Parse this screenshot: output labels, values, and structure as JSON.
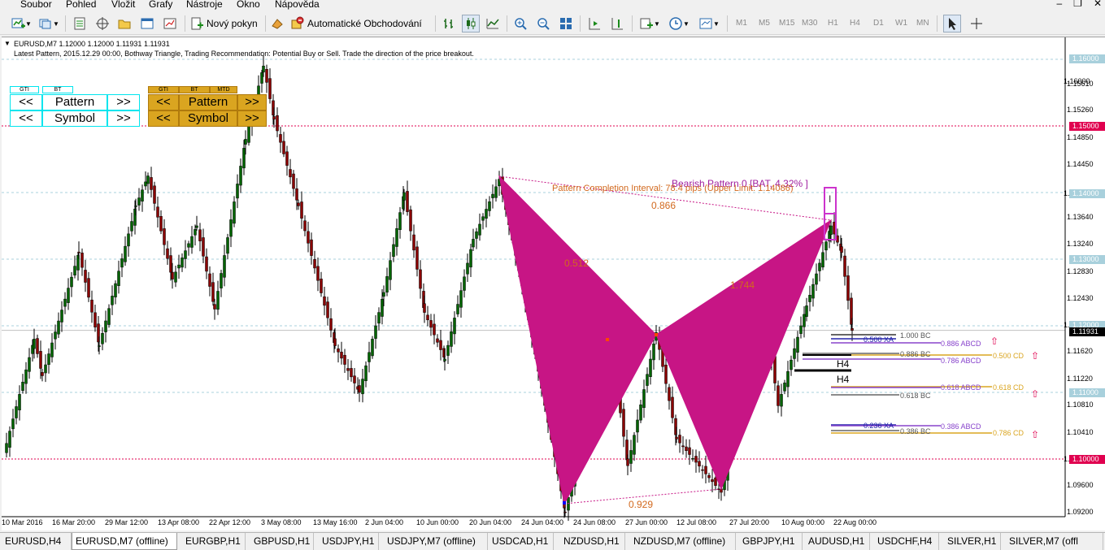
{
  "menu": [
    "Soubor",
    "Pohled",
    "Vložit",
    "Grafy",
    "Nástroje",
    "Okno",
    "Nápověda"
  ],
  "toolbar": {
    "new_order": "Nový pokyn",
    "auto_trading": "Automatické Obchodování",
    "timeframes": [
      "M1",
      "M5",
      "M15",
      "M30",
      "H1",
      "H4",
      "D1",
      "W1",
      "MN"
    ]
  },
  "chart": {
    "symbol_line": "EURUSD,M7  1.12000 1.12000 1.11931 1.11931",
    "info_line": "Latest Pattern, 2015.12.29 00:00, Bothway Triangle, Trading Recommendation: Potential Buy or Sell. Trade the direction of the price breakout.",
    "panel_cyan": {
      "tags": [
        "GTI",
        "BT"
      ],
      "prev": "<<",
      "next": ">>",
      "row1": "Pattern",
      "row2": "Symbol"
    },
    "panel_gold": {
      "tags": [
        "GTI",
        "BT",
        "MTD"
      ],
      "prev": "<<",
      "next": ">>",
      "row1": "Pattern",
      "row2": "Symbol"
    },
    "pattern_title": "Bearish Pattern 0  [BAT, 4.32% ]",
    "pattern_interval": "Pattern Completion Interval: 78.4 pips (Upper Limit: 1.14086)",
    "ratios": [
      "0.866",
      "0.512",
      "1.744",
      "0.929"
    ],
    "prz_marker": "I",
    "levels": [
      {
        "label": "1.000 BC",
        "color": "#333333"
      },
      {
        "label": "0.500 XA",
        "color": "#2222aa"
      },
      {
        "label": "0.886 ABCD",
        "color": "#8844cc"
      },
      {
        "label": "0.886 BC",
        "color": "#666666"
      },
      {
        "label": "0.500 CD",
        "color": "#daa520"
      },
      {
        "label": "0.786 ABCD",
        "color": "#8844cc"
      },
      {
        "label": "H4",
        "color": "#000000"
      },
      {
        "label": "H4",
        "color": "#000000"
      },
      {
        "label": "0.618 ABCD",
        "color": "#8844cc"
      },
      {
        "label": "0.618 CD",
        "color": "#daa520"
      },
      {
        "label": "0.618 BC",
        "color": "#666666"
      },
      {
        "label": "0.236 XA",
        "color": "#2222aa"
      },
      {
        "label": "0.386 ABCD",
        "color": "#8844cc"
      },
      {
        "label": "0.386 BC",
        "color": "#666666"
      },
      {
        "label": "0.786 CD",
        "color": "#daa520"
      }
    ],
    "price_axis": [
      "1.16000",
      "1.15610",
      "1.15260",
      "1.14850",
      "1.14450",
      "1.14000",
      "1.13640",
      "1.13240",
      "1.12830",
      "1.12430",
      "1.12000",
      "1.11620",
      "1.11220",
      "1.10810",
      "1.10410",
      "1.10000",
      "1.09600",
      "1.09200"
    ],
    "price_tags": [
      {
        "text": "1.15000",
        "color": "#e0004f"
      },
      {
        "text": "1.14000",
        "color": "#a8d0dc"
      },
      {
        "text": "1.13000",
        "color": "#a8d0dc"
      },
      {
        "text": "1.12000",
        "color": "#a8d0dc"
      },
      {
        "text": "1.11931",
        "color": "#000000"
      },
      {
        "text": "1.11000",
        "color": "#a8d0dc"
      },
      {
        "text": "1.10000",
        "color": "#e0004f"
      }
    ],
    "time_axis": [
      "10 Mar 2016",
      "16 Mar 20:00",
      "29 Mar 12:00",
      "13 Apr 08:00",
      "22 Apr 12:00",
      "3 May 08:00",
      "13 May 16:00",
      "2 Jun 04:00",
      "10 Jun 00:00",
      "20 Jun 04:00",
      "24 Jun 04:00",
      "24 Jun 08:00",
      "27 Jun 00:00",
      "12 Jul 08:00",
      "27 Jul 20:00",
      "10 Aug 00:00",
      "22 Aug 00:00"
    ],
    "colors": {
      "pattern_fill": "#c71585",
      "bull": "#006400",
      "bear": "#8b0000",
      "grid": "#a8d0dc",
      "level_red": "#e0004f"
    }
  },
  "tabs": [
    "EURUSD,H4",
    "EURUSD,M7 (offline)",
    "EURGBP,H1",
    "GBPUSD,H1",
    "USDJPY,H1",
    "USDJPY,M7 (offline)",
    "USDCAD,H1",
    "NZDUSD,H1",
    "NZDUSD,M7 (offline)",
    "GBPJPY,H1",
    "AUDUSD,H1",
    "USDCHF,H4",
    "SILVER,H1",
    "SILVER,M7 (offl"
  ],
  "active_tab": "EURUSD,M7 (offline)"
}
